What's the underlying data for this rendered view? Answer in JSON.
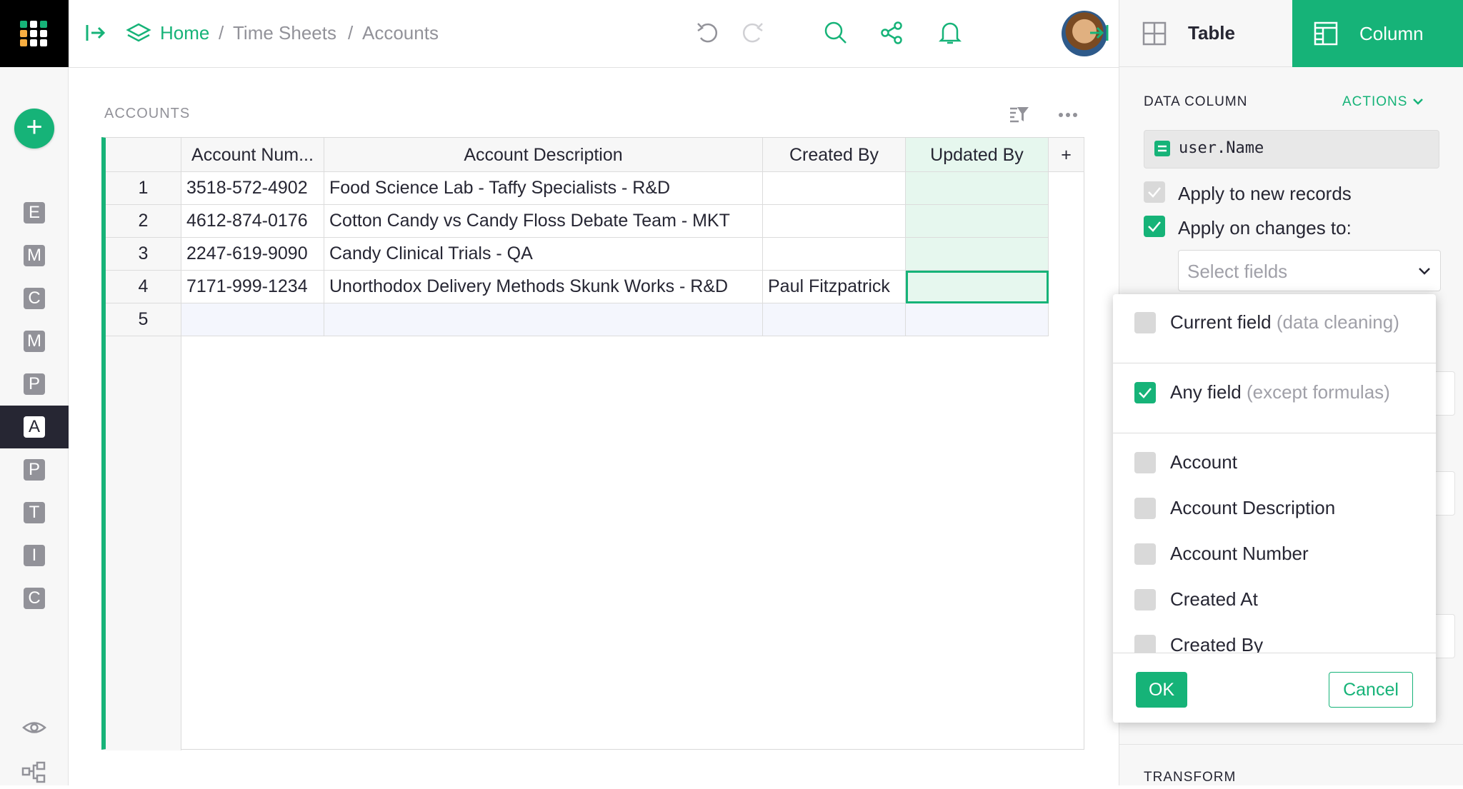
{
  "rail": {
    "items": [
      "E",
      "M",
      "C",
      "M",
      "P",
      "A",
      "P",
      "T",
      "I",
      "C"
    ],
    "active_index": 5,
    "icons": [
      "eye-icon",
      "raw-data-icon"
    ]
  },
  "breadcrumb": {
    "home": "Home",
    "separator": "/",
    "doc": "Time Sheets",
    "page": "Accounts"
  },
  "section": {
    "title": "ACCOUNTS"
  },
  "grid": {
    "columns": [
      "Account Num...",
      "Account Description",
      "Created By",
      "Updated By",
      "+"
    ],
    "rows": [
      {
        "num": "1",
        "account_number": "3518-572-4902",
        "description": "Food Science Lab - Taffy Specialists - R&D",
        "created_by": "",
        "updated_by": ""
      },
      {
        "num": "2",
        "account_number": "4612-874-0176",
        "description": "Cotton Candy vs Candy Floss Debate Team - MKT",
        "created_by": "",
        "updated_by": ""
      },
      {
        "num": "3",
        "account_number": "2247-619-9090",
        "description": "Candy Clinical Trials - QA",
        "created_by": "",
        "updated_by": ""
      },
      {
        "num": "4",
        "account_number": "7171-999-1234",
        "description": "Unorthodox Delivery Methods Skunk Works - R&D",
        "created_by": "Paul Fitzpatrick",
        "updated_by": ""
      }
    ],
    "new_row_num": "5"
  },
  "right_panel": {
    "tab_table": "Table",
    "tab_column": "Column",
    "data_column_label": "DATA COLUMN",
    "actions_label": "ACTIONS",
    "formula": "user.Name",
    "apply_new_records": "Apply to new records",
    "apply_on_changes": "Apply on changes to:",
    "select_placeholder": "Select fields",
    "transform_label": "TRANSFORM"
  },
  "popup": {
    "current_field": "Current field",
    "current_field_hint": "(data cleaning)",
    "any_field": "Any field",
    "any_field_hint": "(except formulas)",
    "fields": [
      "Account",
      "Account Description",
      "Account Number",
      "Created At",
      "Created By"
    ],
    "ok": "OK",
    "cancel": "Cancel"
  },
  "colors": {
    "accent": "#16b378",
    "dark": "#262633",
    "muted": "#929299"
  }
}
